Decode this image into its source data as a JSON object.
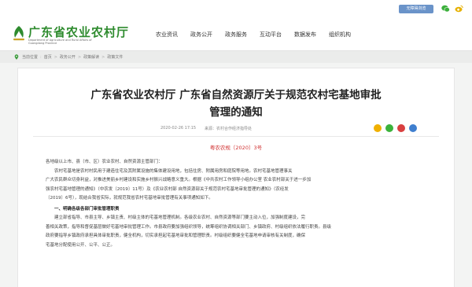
{
  "topbar": {
    "badge": "无障碍浏览",
    "icons": [
      "wechat-icon",
      "weibo-icon"
    ]
  },
  "header": {
    "title": "广东省农业农村厅",
    "subtitle_line1": "Department of Agriculture and Rural Affairs of",
    "subtitle_line2": "Guangdong Province",
    "nav": [
      "农业资讯",
      "政务公开",
      "政务服务",
      "互动平台",
      "数据发布",
      "组织机构"
    ]
  },
  "breadcrumb": {
    "items": [
      "当前位置",
      "首页",
      "政务公开",
      "政策解读",
      "政策文件"
    ]
  },
  "article": {
    "title_line1": "广东省农业农村厅 广东省自然资源厅关于规范农村宅基地审批",
    "title_line2": "管理的通知",
    "date": "2020-02-26 17:15",
    "source": "来源：农村合作经济指导处",
    "doc_number": "粤农农规〔2020〕3号",
    "salutation": "各地级以上市、县（市、区）农业农村、自然资源主管部门：",
    "paragraph1_lines": [
      "农村宅基地是农村村民用于建造住宅及其附属设施的集体建设用地，包括住房、附属用房和庭院等用地。农村宅基地管理事关",
      "广大农民群众切身利益，对推进美丽乡村建设和实施乡村振兴战略意义重大。根据《中共农村工作领导小组办公室 农业农村部关于进一步加",
      "强农村宅基地管理的通知》（中农发〔2019〕11号）及《农业农村部 自然资源部关于规范农村宅基地审批管理的通知》（农经发",
      "〔2019〕6号），现结合我省实际，就规范我省农村宅基地审批管理有关事项通知如下。"
    ],
    "section1_heading": "一、明确各级各部门审批管理职责",
    "section1_lines": [
      "建立部省指导、市县主导、乡镇主责、村级主体的宅基地管理机制。各级农业农村、自然资源等部门要主动入位，加强制度建设，完",
      "善相关政策，指导和督促基层做好宅基地审批管理工作。市县政府要加强组织领导，统筹组织协调相关部门、乡镇政府、村级组织依法履行职责。县级",
      "政府要指导乡镇政府承担具体审批职责，健全机构，切实承担起宅基地审批和管理职责。村级组织要健全宅基地申请审核有关制度，确保",
      "宅基地分配使用公开、公平、公正。"
    ]
  }
}
